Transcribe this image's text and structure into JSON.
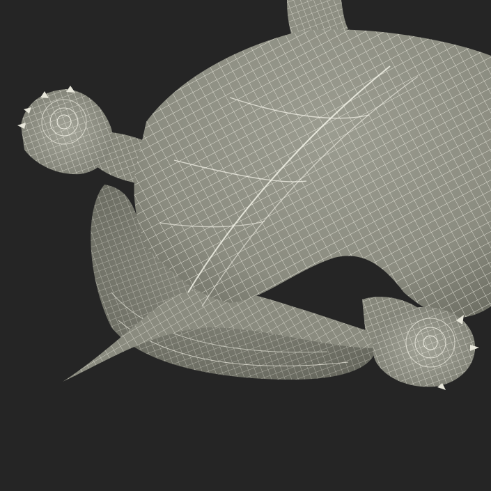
{
  "scene": {
    "subject": "turtle-wireframe-3d-model",
    "background_color": "#252525",
    "mesh_fill_color": "#8e8f84",
    "mesh_shadow_color": "#6c6d62",
    "wire_color": "#f2f1e6"
  }
}
